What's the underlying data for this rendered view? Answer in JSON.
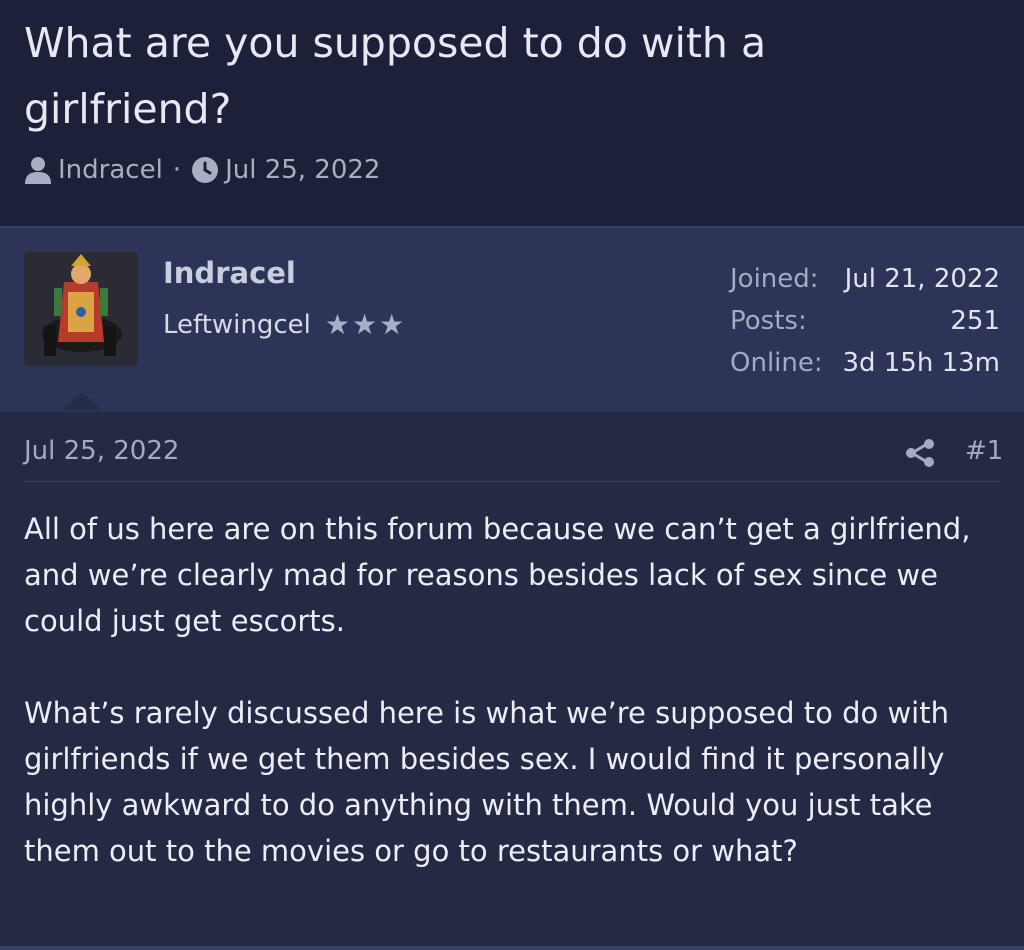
{
  "thread": {
    "title": "What are you supposed to do with a girlfriend?",
    "author": "Indracel",
    "separator": "·",
    "date": "Jul 25, 2022"
  },
  "user": {
    "name": "Indracel",
    "title": "Leftwingcel",
    "stars": "★★★",
    "stats": [
      {
        "label": "Joined:",
        "value": "Jul 21, 2022"
      },
      {
        "label": "Posts:",
        "value": "251"
      },
      {
        "label": "Online:",
        "value": "3d 15h 13m"
      }
    ]
  },
  "post": {
    "date": "Jul 25, 2022",
    "number": "#1",
    "paragraphs": [
      "All of us here are on this forum because we can’t get a girlfriend, and we’re clearly mad for reasons besides lack of sex since we could just get escorts.",
      "What’s rarely discussed here is what we’re supposed to do with girlfriends if we get them besides sex. I would find it personally highly awkward to do anything with them. Would you just take them out to the movies or go to restaurants or what?"
    ]
  },
  "icons": {
    "author": "user-icon",
    "date": "clock-icon",
    "share": "share-icon"
  },
  "colors": {
    "header_bg": "#1c2139",
    "panel_bg": "#2e3457",
    "page_bg": "#242a44"
  }
}
